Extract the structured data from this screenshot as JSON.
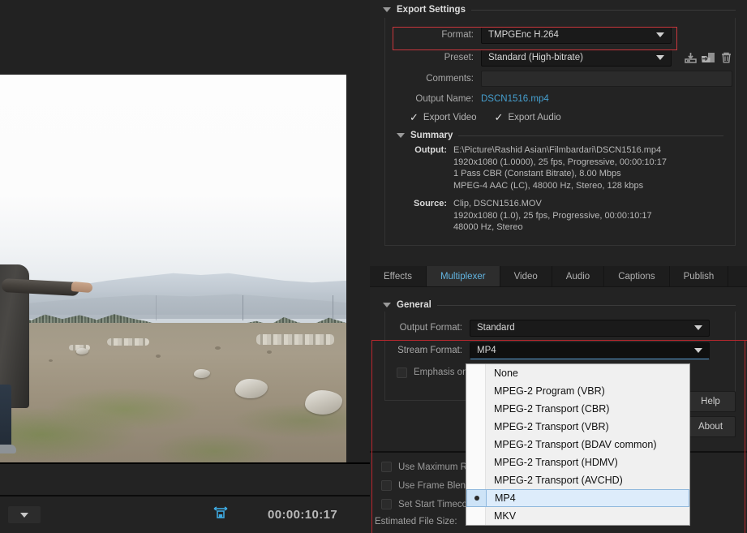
{
  "preview": {
    "timecode": "00:00:10:17",
    "fit_icon": "fit-to-width-icon",
    "zoom_dropdown": "zoom-level-dropdown"
  },
  "export_settings": {
    "title": "Export Settings",
    "format_label": "Format:",
    "format_value": "TMPGEnc H.264",
    "preset_label": "Preset:",
    "preset_value": "Standard (High-bitrate)",
    "comments_label": "Comments:",
    "comments_value": "",
    "output_name_label": "Output Name:",
    "output_name_value": "DSCN1516.mp4",
    "export_video_label": "Export Video",
    "export_audio_label": "Export Audio",
    "preset_icons": [
      "save-preset-icon",
      "import-preset-icon",
      "delete-preset-icon"
    ]
  },
  "summary": {
    "title": "Summary",
    "output_label": "Output:",
    "output_lines": [
      "E:\\Picture\\Rashid Asian\\Filmbardari\\DSCN1516.mp4",
      "1920x1080 (1.0000), 25 fps, Progressive, 00:00:10:17",
      "1 Pass CBR (Constant Bitrate), 8.00 Mbps",
      "MPEG-4 AAC (LC), 48000 Hz, Stereo, 128 kbps"
    ],
    "source_label": "Source:",
    "source_lines": [
      "Clip, DSCN1516.MOV",
      "1920x1080 (1.0), 25 fps, Progressive, 00:00:10:17",
      "48000 Hz, Stereo"
    ]
  },
  "tabs": [
    {
      "label": "Effects",
      "active": false
    },
    {
      "label": "Multiplexer",
      "active": true
    },
    {
      "label": "Video",
      "active": false
    },
    {
      "label": "Audio",
      "active": false
    },
    {
      "label": "Captions",
      "active": false
    },
    {
      "label": "Publish",
      "active": false
    }
  ],
  "general": {
    "title": "General",
    "output_format_label": "Output Format:",
    "output_format_value": "Standard",
    "stream_format_label": "Stream Format:",
    "stream_format_value": "MP4",
    "emphasis_label": "Emphasis on p"
  },
  "stream_format_dropdown": {
    "selected": "MP4",
    "options": [
      "None",
      "MPEG-2 Program (VBR)",
      "MPEG-2 Transport (CBR)",
      "MPEG-2 Transport (VBR)",
      "MPEG-2 Transport (BDAV common)",
      "MPEG-2 Transport (HDMV)",
      "MPEG-2 Transport (AVCHD)",
      "MP4",
      "MKV"
    ]
  },
  "side_buttons": {
    "help": "Help",
    "about": "About"
  },
  "bottom_options": {
    "use_max_render": "Use Maximum Re",
    "use_frame_blend": "Use Frame Blend",
    "set_start_timecode": "Set Start Timeco",
    "estimated_file_size_label": "Estimated File Size:"
  },
  "colors": {
    "panel_bg": "#232323",
    "accent_blue": "#46a0d0",
    "highlight_red": "#b8272e",
    "tab_active_text": "#62b4e0"
  }
}
